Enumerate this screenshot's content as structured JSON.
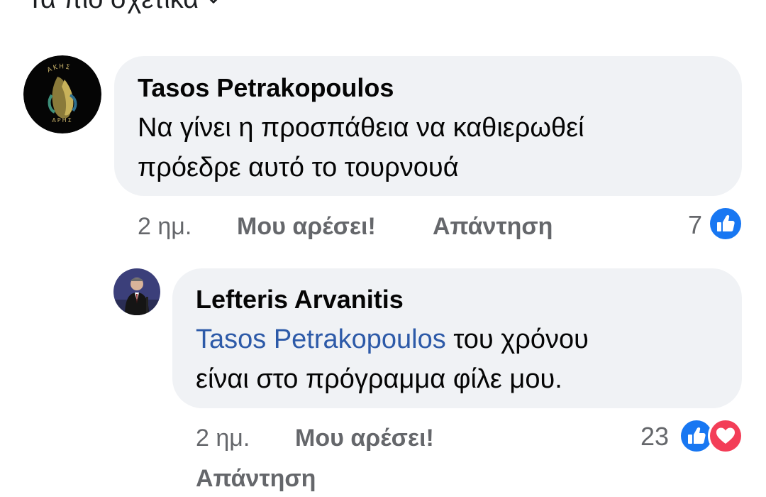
{
  "sort": {
    "label": "Τα πιο σχετικά"
  },
  "comments": [
    {
      "author": "Tasos Petrakopoulos",
      "text_lines": [
        "Να γίνει η προσπάθεια να καθιερωθεί",
        "πρόεδρε αυτό το τουρνουά"
      ],
      "time": "2 ημ.",
      "like_label": "Μου αρέσει!",
      "reply_label": "Απάντηση",
      "reaction_count": "7",
      "reactions": [
        "like-icon"
      ],
      "avatar_text_top": "ΑΚΗΣ",
      "avatar_text_bottom": "ΑΡΗΣ"
    },
    {
      "author": "Lefteris Arvanitis",
      "mention": "Tasos Petrakopoulos",
      "text_after_mention": " του χρόνου",
      "text_line2": "είναι στο πρόγραμμα φίλε μου.",
      "time": "2 ημ.",
      "like_label": "Μου αρέσει!",
      "reply_label": "Απάντηση",
      "reaction_count": "23",
      "reactions": [
        "like-icon",
        "love-icon"
      ]
    }
  ],
  "colors": {
    "bubble": "#f0f2f5",
    "like": "#1877f2",
    "love": "#f33e58",
    "mention": "#2d5aa8",
    "meta": "#65676b"
  }
}
